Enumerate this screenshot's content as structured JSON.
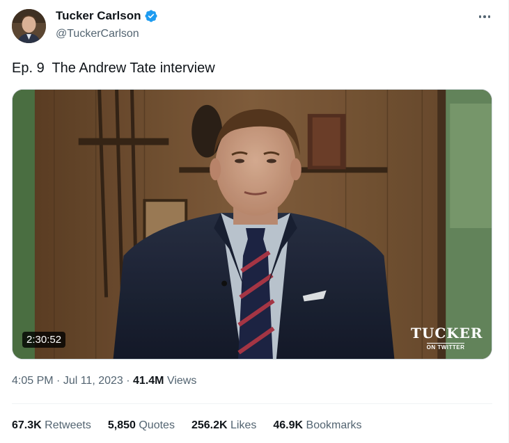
{
  "author": {
    "display_name": "Tucker Carlson",
    "handle": "@TuckerCarlson",
    "verified": true,
    "verified_color": "#1d9bf0"
  },
  "tweet": {
    "text": "Ep. 9  The Andrew Tate interview"
  },
  "video": {
    "duration": "2:30:52",
    "brand_title": "TUCKER",
    "brand_subtitle": "ON TWITTER"
  },
  "meta": {
    "time": "4:05 PM",
    "date": "Jul 11, 2023",
    "views_count": "41.4M",
    "views_label": "Views",
    "separator": " · "
  },
  "stats": {
    "retweets_count": "67.3K",
    "retweets_label": "Retweets",
    "quotes_count": "5,850",
    "quotes_label": "Quotes",
    "likes_count": "256.2K",
    "likes_label": "Likes",
    "bookmarks_count": "46.9K",
    "bookmarks_label": "Bookmarks"
  },
  "colors": {
    "text_primary": "#0f1419",
    "text_secondary": "#536471",
    "divider": "#eff3f4"
  },
  "icons": {
    "more": "more-horizontal-icon",
    "verified": "verified-badge-icon"
  }
}
